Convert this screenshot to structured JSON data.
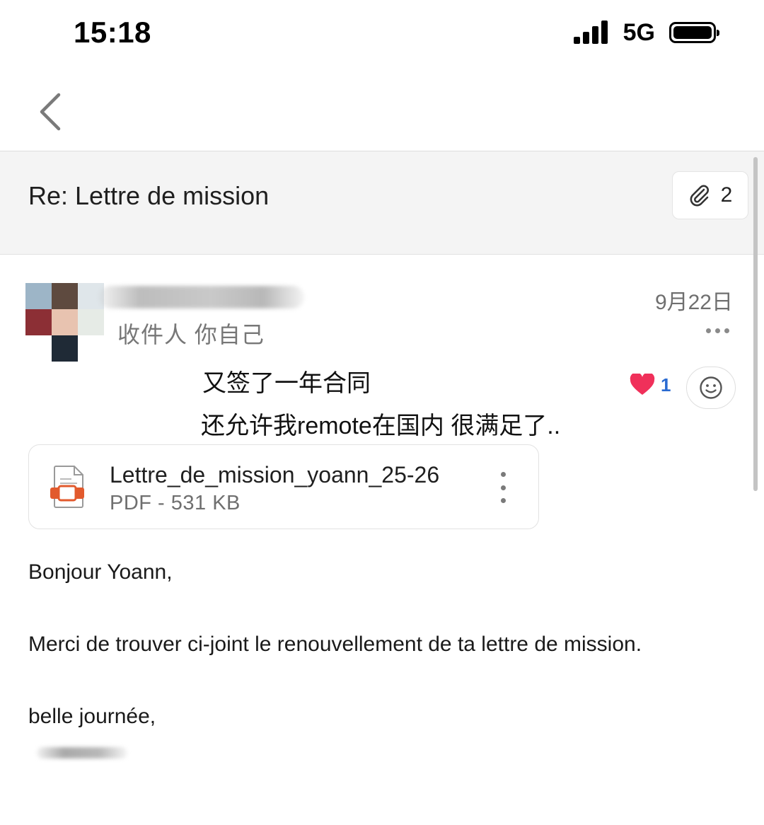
{
  "status_bar": {
    "time": "15:18",
    "network": "5G",
    "signal_icon": "signal-bars-icon",
    "battery_icon": "battery-icon"
  },
  "nav": {
    "back_icon": "chevron-left-icon"
  },
  "email": {
    "subject": "Re: Lettre de mission",
    "attachment_count": "2",
    "recipient": "收件人 你自己",
    "date": "9月22日"
  },
  "note": {
    "line1": "又签了一年合同",
    "line2": "还允许我remote在国内 很满足了.."
  },
  "reaction": {
    "icon": "heart-icon",
    "count": "1",
    "color": "#f0305a"
  },
  "attachment": {
    "name": "Lettre_de_mission_yoann_25-26",
    "meta": "PDF - 531 KB",
    "icon_color": "#e25a2d"
  },
  "body": {
    "greeting": "Bonjour Yoann,",
    "paragraph": "Merci de trouver ci-joint le renouvellement de ta lettre de mission.",
    "closing": "belle journée,"
  }
}
